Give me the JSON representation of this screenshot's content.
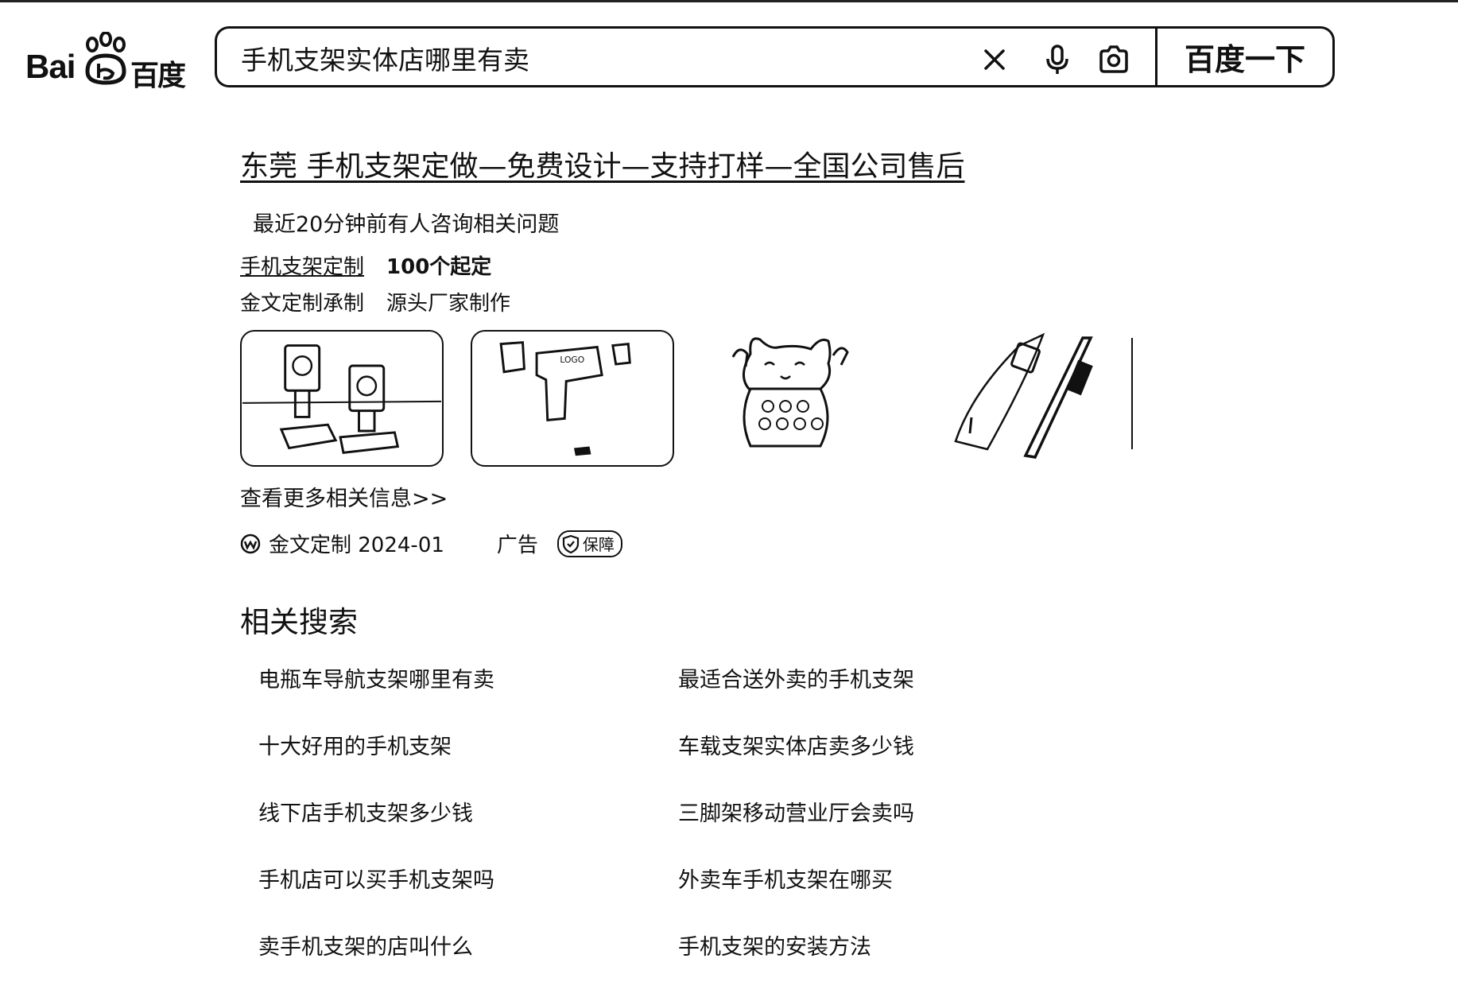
{
  "header": {
    "logo_text_latin": "Bai",
    "logo_text_cn": "百度",
    "search_query": "手机支架实体店哪里有卖",
    "search_button_label": "百度一下"
  },
  "ad_result": {
    "title": "东莞 手机支架定做—免费设计—支持打样—全国公司售后",
    "consult_note": "最近20分钟前有人咨询相关问题",
    "tag_link": "手机支架定制",
    "tag_min_order": "100个起定",
    "tag_service": "金文定制承制",
    "tag_factory": "源头厂家制作",
    "thumbnail_1_logo": "LOGO",
    "more_link": "查看更多相关信息>>",
    "source_name": "金文定制 2024-01",
    "ad_label": "广告",
    "guarantee_label": "保障"
  },
  "related": {
    "heading": "相关搜索",
    "items": [
      "电瓶车导航支架哪里有卖",
      "最适合送外卖的手机支架",
      "十大好用的手机支架",
      "车载支架实体店卖多少钱",
      "线下店手机支架多少钱",
      "三脚架移动营业厅会卖吗",
      "手机店可以买手机支架吗",
      "外卖车手机支架在哪买",
      "卖手机支架的店叫什么",
      "手机支架的安装方法"
    ]
  }
}
